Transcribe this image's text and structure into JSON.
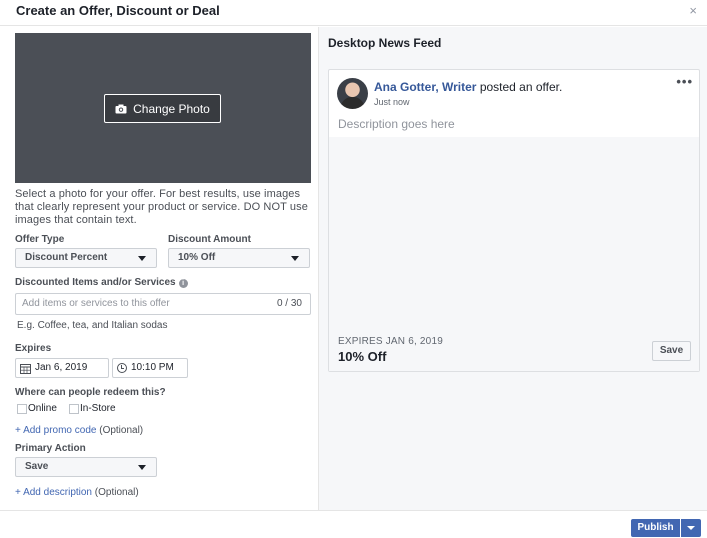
{
  "dialog": {
    "title": "Create an Offer, Discount or Deal",
    "close_glyph": "×"
  },
  "left": {
    "change_photo_label": "Change Photo",
    "photo_help": "Select a photo for your offer. For best results, use images that clearly represent your product or service. DO NOT use images that contain text.",
    "offer_type_label": "Offer Type",
    "offer_type_value": "Discount Percent",
    "discount_amount_label": "Discount Amount",
    "discount_amount_value": "10% Off",
    "discounted_items_label": "Discounted Items and/or Services",
    "discounted_items_placeholder": "Add items or services to this offer",
    "discounted_items_counter": "0 / 30",
    "example_hint": "E.g. Coffee, tea, and Italian sodas",
    "expires_label": "Expires",
    "expires_date": "Jan 6, 2019",
    "expires_time": "10:10 PM",
    "redeem_label": "Where can people redeem this?",
    "redeem_online": "Online",
    "redeem_instore": "In-Store",
    "promo_link": "+ Add promo code",
    "promo_optional": "(Optional)",
    "primary_action_label": "Primary Action",
    "primary_action_value": "Save",
    "description_link": "+ Add description",
    "description_optional": "(Optional)"
  },
  "preview": {
    "title": "Desktop News Feed",
    "author": "Ana Gotter",
    "author_role": "Writer",
    "posted_text": "posted an offer.",
    "time": "Just now",
    "description_placeholder": "Description goes here",
    "expires": "EXPIRES JAN 6, 2019",
    "offer": "10% Off",
    "save_label": "Save",
    "more_glyph": "•••"
  },
  "footer": {
    "publish_label": "Publish"
  },
  "colors": {
    "accent": "#4267b2",
    "photo_bg": "#4b4f56",
    "link": "#4267b2"
  }
}
